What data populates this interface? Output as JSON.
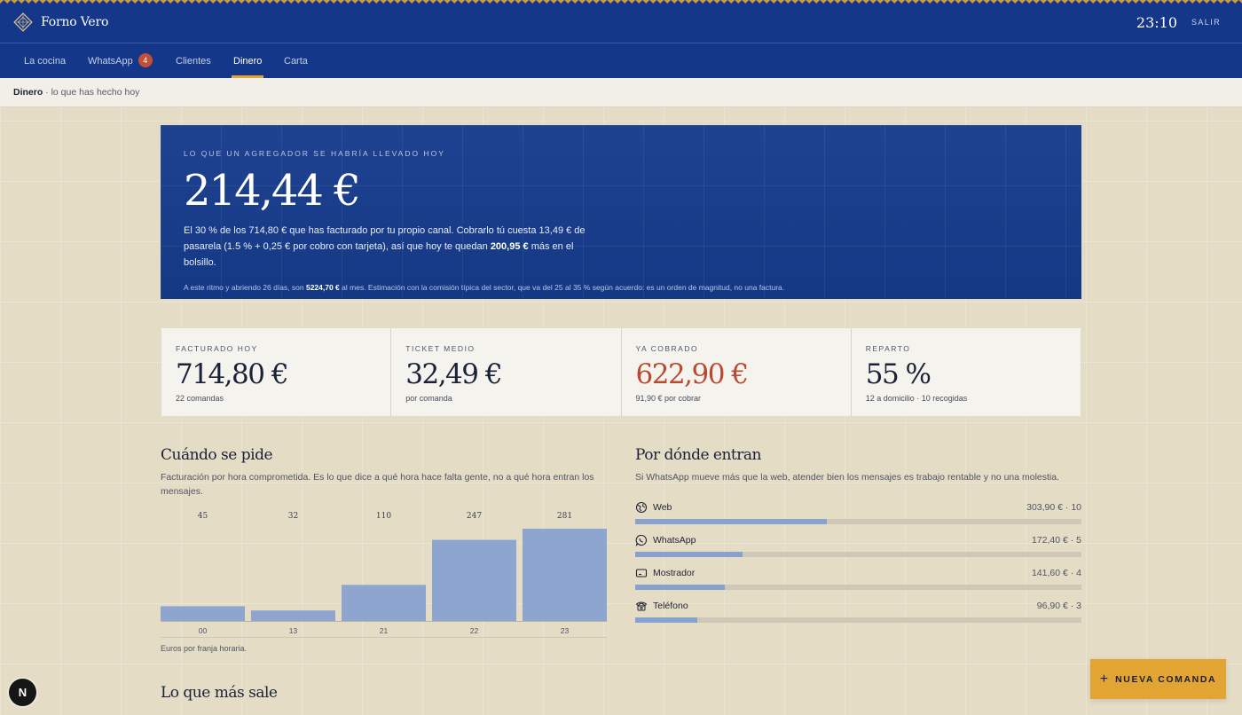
{
  "header": {
    "brand": "Forno Vero",
    "time": "23:10",
    "logout_label": "SALIR"
  },
  "nav": {
    "items": [
      {
        "label": "La cocina"
      },
      {
        "label": "WhatsApp",
        "badge": "4"
      },
      {
        "label": "Clientes"
      },
      {
        "label": "Dinero",
        "active": true
      },
      {
        "label": "Carta"
      }
    ]
  },
  "breadcrumb": {
    "current": "Dinero",
    "rest": " · lo que has hecho hoy"
  },
  "hero": {
    "label": "LO QUE UN AGREGADOR SE HABRÍA LLEVADO HOY",
    "amount": "214,44 €",
    "text_1": "El 30 % de los 714,80 € que has facturado por tu propio canal. Cobrarlo tú cuesta 13,49 € de pasarela (1.5 % + 0,25 € por cobro con tarjeta), así que hoy te quedan ",
    "text_bold": "200,95 €",
    "text_2": " más en el bolsillo.",
    "note_1": "A este ritmo y abriendo 26 días, son ",
    "note_bold": "5224,70 €",
    "note_2": " al mes. Estimación con la comisión típica del sector, que va del 25 al 35 % según acuerdo: es un orden de magnitud, no una factura."
  },
  "stats": [
    {
      "label": "FACTURADO HOY",
      "value": "714,80 €",
      "sub": "22 comandas"
    },
    {
      "label": "TICKET MEDIO",
      "value": "32,49 €",
      "sub": "por comanda"
    },
    {
      "label": "YA COBRADO",
      "value": "622,90 €",
      "sub": "91,90 € por cobrar",
      "accent": true
    },
    {
      "label": "REPARTO",
      "value": "55 %",
      "sub": "12 a domicilio · 10 recogidas"
    }
  ],
  "when": {
    "title": "Cuándo se pide",
    "desc": "Facturación por hora comprometida. Es lo que dice a qué hora hace falta gente, no a qué hora entran los mensajes.",
    "caption": "Euros por franja horaria."
  },
  "chart_data": {
    "type": "bar",
    "categories": [
      "00",
      "13",
      "21",
      "22",
      "23"
    ],
    "values": [
      45,
      32,
      110,
      247,
      281
    ],
    "title": "Cuándo se pide",
    "xlabel": "",
    "ylabel": "",
    "ylim": [
      0,
      281
    ],
    "bar_color": "#8ea6cf"
  },
  "channels": {
    "title": "Por dónde entran",
    "desc": "Si WhatsApp mueve más que la web, atender bien los mensajes es trabajo rentable y no una molestia.",
    "items": [
      {
        "icon": "globe-icon",
        "name": "Web",
        "value": "303,90 € · 10",
        "share": 0.43
      },
      {
        "icon": "whatsapp-icon",
        "name": "WhatsApp",
        "value": "172,40 € · 5",
        "share": 0.24
      },
      {
        "icon": "counter-icon",
        "name": "Mostrador",
        "value": "141,60 € · 4",
        "share": 0.2
      },
      {
        "icon": "phone-icon",
        "name": "Teléfono",
        "value": "96,90 € · 3",
        "share": 0.14
      }
    ]
  },
  "top_sellers": {
    "title": "Lo que más sale"
  },
  "fab": {
    "label": "NUEVA COMANDA"
  },
  "corner_button": {
    "label": "N"
  },
  "colors": {
    "primary": "#14378a",
    "accent": "#e2a534",
    "danger": "#b94a2f",
    "bar": "#8ea6cf"
  }
}
